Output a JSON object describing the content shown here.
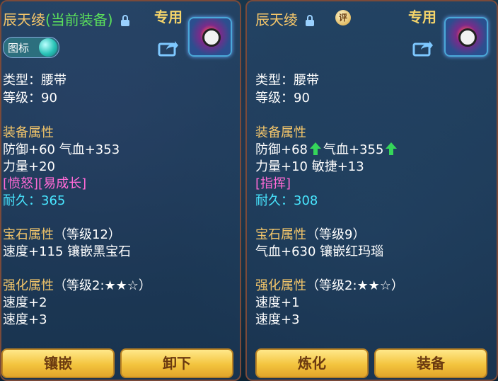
{
  "left_panel": {
    "item_name": "辰天绫",
    "current_tag": "(当前装备)",
    "special_label": "专用",
    "icon_toggle_label": "图标",
    "type_label": "类型：",
    "type_value": "腰带",
    "level_label": "等级：",
    "level_value": "90",
    "equip_attr_title": "装备属性",
    "attr_line1": "防御+60 气血+353",
    "attr_line2": "力量+20",
    "special_effects": "[愤怒][易成长]",
    "durability_label": "耐久：",
    "durability_value": "365",
    "gem_title": "宝石属性",
    "gem_level": "（等级12）",
    "gem_detail": "速度+115 镶嵌黑宝石",
    "enhance_title": "强化属性",
    "enhance_level": "（等级2:★★☆）",
    "enhance_line1": "速度+2",
    "enhance_line2": "速度+3",
    "buttons": {
      "inlay": "镶嵌",
      "unequip": "卸下"
    }
  },
  "right_panel": {
    "item_name": "辰天绫",
    "rating_badge": "评",
    "special_label": "专用",
    "type_label": "类型：",
    "type_value": "腰带",
    "level_label": "等级：",
    "level_value": "90",
    "equip_attr_title": "装备属性",
    "defense": "防御+68",
    "hp": "气血+355",
    "attr_line2": "力量+10 敏捷+13",
    "special_effects": "[指挥]",
    "durability_label": "耐久：",
    "durability_value": "308",
    "gem_title": "宝石属性",
    "gem_level": "（等级9）",
    "gem_detail": "气血+630 镶嵌红玛瑙",
    "enhance_title": "强化属性",
    "enhance_level": "（等级2:★★☆）",
    "enhance_line1": "速度+1",
    "enhance_line2": "速度+3",
    "buttons": {
      "refine": "炼化",
      "equip": "装备"
    }
  },
  "icons": {
    "lock": "lock-icon",
    "share": "share-icon",
    "up_arrow": "up-arrow-icon",
    "item": "belt-item-icon"
  },
  "colors": {
    "gold_text": "#f4c66a",
    "green_text": "#5be05b",
    "pink_text": "#ff6ad6",
    "cyan_text": "#48e6ff",
    "button_gold": "#f3c43e"
  }
}
